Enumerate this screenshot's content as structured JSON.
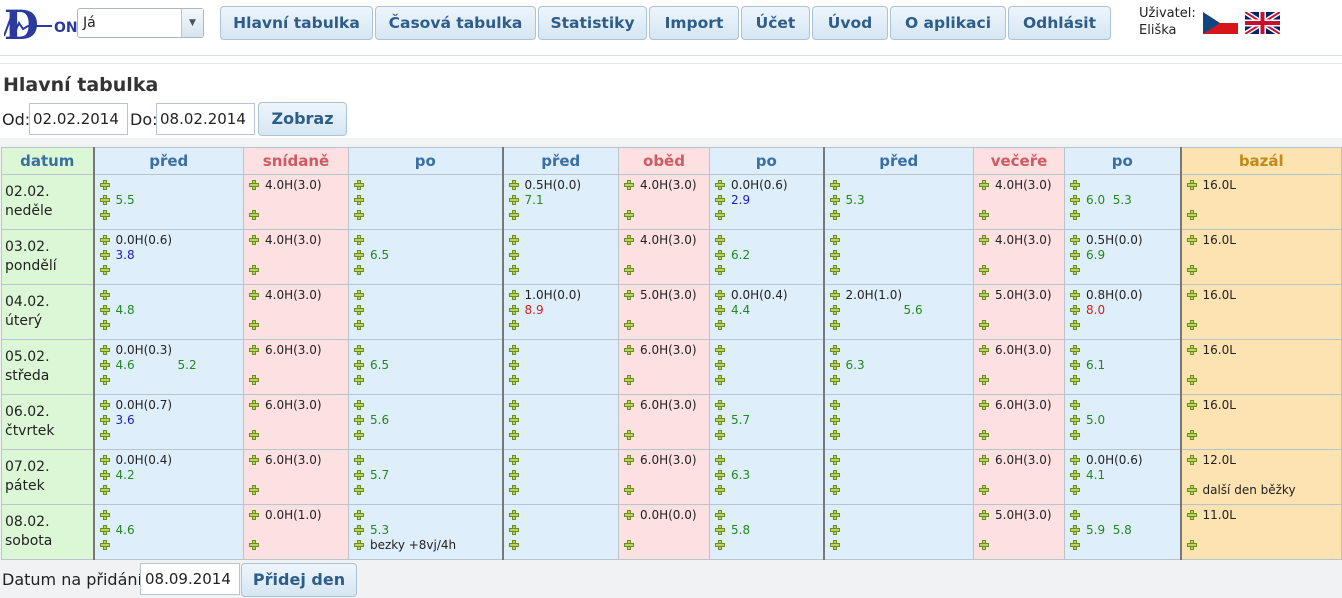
{
  "user_select": {
    "value": "Já"
  },
  "nav": [
    "Hlavní tabulka",
    "Časová tabulka",
    "Statistiky",
    "Import",
    "Účet",
    "Úvod",
    "O aplikaci",
    "Odhlásit"
  ],
  "user_label": "Uživatel:",
  "user_name": "Eliška",
  "page_title": "Hlavní tabulka",
  "filter": {
    "from_label": "Od:",
    "from_value": "02.02.2014",
    "to_label": "Do:",
    "to_value": "08.02.2014",
    "show_button": "Zobraz"
  },
  "table": {
    "headers": [
      "datum",
      "před",
      "snídaně",
      "po",
      "před",
      "oběd",
      "po",
      "před",
      "večeře",
      "po",
      "bazál"
    ],
    "rows": [
      {
        "date": "02.02.",
        "day": "neděle",
        "cells": [
          [
            [
              "",
              ""
            ],
            [
              "5.5",
              "g"
            ],
            [
              "",
              ""
            ]
          ],
          [
            [
              "4.0H(3.0)",
              "k"
            ],
            [
              "",
              "x"
            ],
            [
              "",
              ""
            ]
          ],
          [
            [
              "",
              ""
            ],
            [
              "",
              ""
            ],
            [
              "",
              ""
            ]
          ],
          [
            [
              "0.5H(0.0)",
              "k"
            ],
            [
              "7.1",
              "g"
            ],
            [
              "",
              ""
            ]
          ],
          [
            [
              "4.0H(3.0)",
              "k"
            ],
            [
              "",
              "x"
            ],
            [
              "",
              ""
            ]
          ],
          [
            [
              "0.0H(0.6)",
              "k"
            ],
            [
              "2.9",
              "b"
            ],
            [
              "",
              ""
            ]
          ],
          [
            [
              "",
              ""
            ],
            [
              "5.3",
              "g"
            ],
            [
              "",
              ""
            ]
          ],
          [
            [
              "4.0H(3.0)",
              "k"
            ],
            [
              "",
              "x"
            ],
            [
              "",
              ""
            ]
          ],
          [
            [
              "",
              ""
            ],
            [
              "6.0  5.3",
              "g"
            ],
            [
              "",
              ""
            ]
          ],
          [
            [
              "16.0L",
              "k"
            ],
            [
              "",
              "x"
            ],
            [
              "",
              ""
            ]
          ]
        ]
      },
      {
        "date": "03.02.",
        "day": "pondělí",
        "cells": [
          [
            [
              "0.0H(0.6)",
              "k"
            ],
            [
              "3.8",
              "b"
            ],
            [
              "",
              ""
            ]
          ],
          [
            [
              "4.0H(3.0)",
              "k"
            ],
            [
              "",
              "x"
            ],
            [
              "",
              ""
            ]
          ],
          [
            [
              "",
              ""
            ],
            [
              "6.5",
              "g"
            ],
            [
              "",
              ""
            ]
          ],
          [
            [
              "",
              ""
            ],
            [
              "",
              ""
            ],
            [
              "",
              ""
            ]
          ],
          [
            [
              "4.0H(3.0)",
              "k"
            ],
            [
              "",
              "x"
            ],
            [
              "",
              ""
            ]
          ],
          [
            [
              "",
              ""
            ],
            [
              "6.2",
              "g"
            ],
            [
              "",
              ""
            ]
          ],
          [
            [
              "",
              ""
            ],
            [
              "",
              ""
            ],
            [
              "",
              ""
            ]
          ],
          [
            [
              "4.0H(3.0)",
              "k"
            ],
            [
              "",
              "x"
            ],
            [
              "",
              ""
            ]
          ],
          [
            [
              "0.5H(0.0)",
              "k"
            ],
            [
              "6.9",
              "g"
            ],
            [
              "",
              ""
            ]
          ],
          [
            [
              "16.0L",
              "k"
            ],
            [
              "",
              "x"
            ],
            [
              "",
              ""
            ]
          ]
        ]
      },
      {
        "date": "04.02.",
        "day": "úterý",
        "cells": [
          [
            [
              "",
              ""
            ],
            [
              "4.8",
              "g"
            ],
            [
              "",
              ""
            ]
          ],
          [
            [
              "4.0H(3.0)",
              "k"
            ],
            [
              "",
              "x"
            ],
            [
              "",
              ""
            ]
          ],
          [
            [
              "",
              ""
            ],
            [
              "",
              ""
            ],
            [
              "",
              ""
            ]
          ],
          [
            [
              "1.0H(0.0)",
              "k"
            ],
            [
              "8.9",
              "r"
            ],
            [
              "",
              ""
            ]
          ],
          [
            [
              "5.0H(3.0)",
              "k"
            ],
            [
              "",
              "x"
            ],
            [
              "",
              ""
            ]
          ],
          [
            [
              "0.0H(0.4)",
              "k"
            ],
            [
              "4.4",
              "g"
            ],
            [
              "",
              ""
            ]
          ],
          [
            [
              "2.0H(1.0)",
              "k"
            ],
            [
              "5.6",
              "g"
            ],
            [
              "",
              ""
            ]
          ],
          [
            [
              "5.0H(3.0)",
              "k"
            ],
            [
              "",
              "x"
            ],
            [
              "",
              ""
            ]
          ],
          [
            [
              "0.8H(0.0)",
              "k"
            ],
            [
              "8.0",
              "r"
            ],
            [
              "",
              ""
            ]
          ],
          [
            [
              "16.0L",
              "k"
            ],
            [
              "",
              "x"
            ],
            [
              "",
              ""
            ]
          ]
        ]
      },
      {
        "date": "05.02.",
        "day": "středa",
        "cells": [
          [
            [
              "0.0H(0.3)",
              "k"
            ],
            [
              "4.6",
              "g"
            ],
            [
              "",
              ""
            ]
          ],
          [
            [
              "6.0H(3.0)",
              "k"
            ],
            [
              "",
              "x"
            ],
            [
              "",
              ""
            ]
          ],
          [
            [
              "",
              ""
            ],
            [
              "6.5",
              "g"
            ],
            [
              "",
              ""
            ]
          ],
          [
            [
              "",
              ""
            ],
            [
              "",
              ""
            ],
            [
              "",
              ""
            ]
          ],
          [
            [
              "6.0H(3.0)",
              "k"
            ],
            [
              "",
              "x"
            ],
            [
              "",
              ""
            ]
          ],
          [
            [
              "",
              ""
            ],
            [
              "",
              ""
            ],
            [
              "",
              ""
            ]
          ],
          [
            [
              "",
              ""
            ],
            [
              "6.3",
              "g"
            ],
            [
              "",
              ""
            ]
          ],
          [
            [
              "6.0H(3.0)",
              "k"
            ],
            [
              "",
              "x"
            ],
            [
              "",
              ""
            ]
          ],
          [
            [
              "",
              ""
            ],
            [
              "6.1",
              "g"
            ],
            [
              "",
              ""
            ]
          ],
          [
            [
              "16.0L",
              "k"
            ],
            [
              "",
              "x"
            ],
            [
              "",
              ""
            ]
          ]
        ]
      },
      {
        "date": "06.02.",
        "day": "čtvrtek",
        "cells": [
          [
            [
              "0.0H(0.7)",
              "k"
            ],
            [
              "3.6",
              "b"
            ],
            [
              "",
              ""
            ]
          ],
          [
            [
              "6.0H(3.0)",
              "k"
            ],
            [
              "",
              "x"
            ],
            [
              "",
              ""
            ]
          ],
          [
            [
              "",
              ""
            ],
            [
              "5.6",
              "g"
            ],
            [
              "",
              ""
            ]
          ],
          [
            [
              "",
              ""
            ],
            [
              "",
              ""
            ],
            [
              "",
              ""
            ]
          ],
          [
            [
              "6.0H(3.0)",
              "k"
            ],
            [
              "",
              "x"
            ],
            [
              "",
              ""
            ]
          ],
          [
            [
              "",
              ""
            ],
            [
              "5.7",
              "g"
            ],
            [
              "",
              ""
            ]
          ],
          [
            [
              "",
              ""
            ],
            [
              "",
              ""
            ],
            [
              "",
              ""
            ]
          ],
          [
            [
              "6.0H(3.0)",
              "k"
            ],
            [
              "",
              "x"
            ],
            [
              "",
              ""
            ]
          ],
          [
            [
              "",
              ""
            ],
            [
              "5.0",
              "g"
            ],
            [
              "",
              ""
            ]
          ],
          [
            [
              "16.0L",
              "k"
            ],
            [
              "",
              "x"
            ],
            [
              "",
              ""
            ]
          ]
        ]
      },
      {
        "date": "07.02.",
        "day": "pátek",
        "cells": [
          [
            [
              "0.0H(0.4)",
              "k"
            ],
            [
              "4.2",
              "g"
            ],
            [
              "",
              ""
            ]
          ],
          [
            [
              "6.0H(3.0)",
              "k"
            ],
            [
              "",
              "x"
            ],
            [
              "",
              ""
            ]
          ],
          [
            [
              "",
              ""
            ],
            [
              "5.7",
              "g"
            ],
            [
              "",
              ""
            ]
          ],
          [
            [
              "",
              ""
            ],
            [
              "",
              ""
            ],
            [
              "",
              ""
            ]
          ],
          [
            [
              "6.0H(3.0)",
              "k"
            ],
            [
              "",
              "x"
            ],
            [
              "",
              ""
            ]
          ],
          [
            [
              "",
              ""
            ],
            [
              "6.3",
              "g"
            ],
            [
              "",
              ""
            ]
          ],
          [
            [
              "",
              ""
            ],
            [
              "",
              ""
            ],
            [
              "",
              ""
            ]
          ],
          [
            [
              "6.0H(3.0)",
              "k"
            ],
            [
              "",
              "x"
            ],
            [
              "",
              ""
            ]
          ],
          [
            [
              "0.0H(0.6)",
              "k"
            ],
            [
              "4.1",
              "g"
            ],
            [
              "",
              ""
            ]
          ],
          [
            [
              "12.0L",
              "k"
            ],
            [
              "",
              "x"
            ],
            [
              "další den běžky",
              "k"
            ]
          ]
        ]
      },
      {
        "date": "08.02.",
        "day": "sobota",
        "cells": [
          [
            [
              "",
              ""
            ],
            [
              "4.6",
              "g"
            ],
            [
              "",
              ""
            ]
          ],
          [
            [
              "0.0H(1.0)",
              "k"
            ],
            [
              "",
              "x"
            ],
            [
              "",
              ""
            ]
          ],
          [
            [
              "",
              ""
            ],
            [
              "5.3",
              "g"
            ],
            [
              "bezky +8vj/4h",
              "k"
            ]
          ],
          [
            [
              "",
              ""
            ],
            [
              "",
              ""
            ],
            [
              "",
              ""
            ]
          ],
          [
            [
              "0.0H(0.0)",
              "k"
            ],
            [
              "",
              "x"
            ],
            [
              "",
              ""
            ]
          ],
          [
            [
              "",
              ""
            ],
            [
              "5.8",
              "g"
            ],
            [
              "",
              ""
            ]
          ],
          [
            [
              "",
              ""
            ],
            [
              "",
              ""
            ],
            [
              "",
              ""
            ]
          ],
          [
            [
              "5.0H(3.0)",
              "k"
            ],
            [
              "",
              "x"
            ],
            [
              "",
              ""
            ]
          ],
          [
            [
              "",
              ""
            ],
            [
              "5.9  5.8",
              "g"
            ],
            [
              "",
              ""
            ]
          ],
          [
            [
              "11.0L",
              "k"
            ],
            [
              "",
              "x"
            ],
            [
              "",
              ""
            ]
          ]
        ]
      }
    ]
  },
  "extra_values": {
    "r3c0": "5.2"
  },
  "add_day": {
    "label": "Datum na přidání:",
    "value": "08.09.2014",
    "button": "Přidej den"
  },
  "colors": {
    "before_after": "#dfeefb",
    "meal": "#fde0e1",
    "basal": "#fde3b1",
    "date": "#dbf7d6",
    "accent": "#2d5d88"
  },
  "icons": {
    "logo": "don-logo",
    "add": "plus-icon",
    "flag_cz": "flag-cz-icon",
    "flag_uk": "flag-uk-icon"
  }
}
